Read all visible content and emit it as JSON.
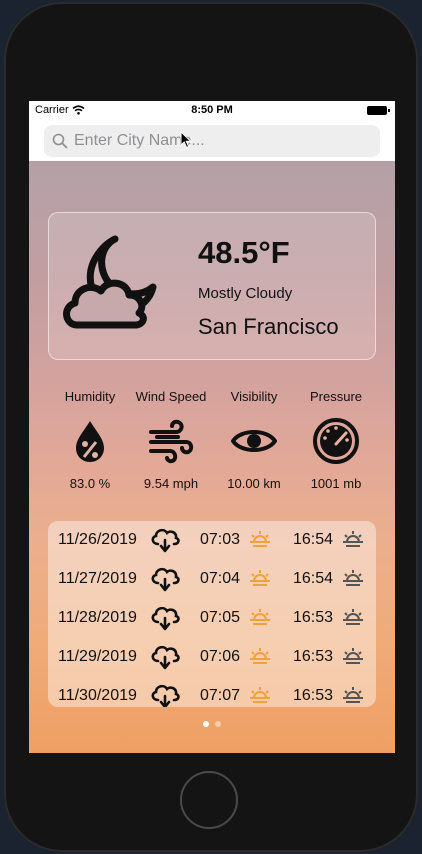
{
  "status_bar": {
    "carrier": "Carrier",
    "time": "8:50 PM"
  },
  "search": {
    "placeholder": "Enter City Name..."
  },
  "current": {
    "temperature": "48.5°F",
    "condition": "Mostly Cloudy",
    "city": "San Francisco",
    "icon": "moon-cloud-icon"
  },
  "stats": [
    {
      "label": "Humidity",
      "value": "83.0 %",
      "icon": "humidity-icon"
    },
    {
      "label": "Wind Speed",
      "value": "9.54 mph",
      "icon": "wind-icon"
    },
    {
      "label": "Visibility",
      "value": "10.00 km",
      "icon": "eye-icon"
    },
    {
      "label": "Pressure",
      "value": "1001 mb",
      "icon": "gauge-icon"
    }
  ],
  "forecast": [
    {
      "date": "11/26/2019",
      "sunrise": "07:03",
      "sunset": "16:54"
    },
    {
      "date": "11/27/2019",
      "sunrise": "07:04",
      "sunset": "16:54"
    },
    {
      "date": "11/28/2019",
      "sunrise": "07:05",
      "sunset": "16:53"
    },
    {
      "date": "11/29/2019",
      "sunrise": "07:06",
      "sunset": "16:53"
    },
    {
      "date": "11/30/2019",
      "sunrise": "07:07",
      "sunset": "16:53"
    }
  ],
  "pager": {
    "pages": 2,
    "current": 1
  },
  "colors": {
    "sunrise": "#f0a23a",
    "text": "#111111"
  }
}
